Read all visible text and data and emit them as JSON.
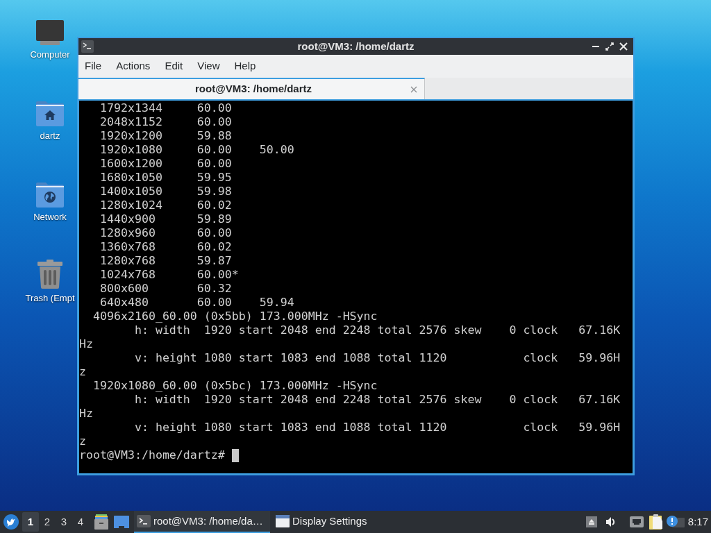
{
  "desktop_icons": [
    {
      "label": "Computer",
      "kind": "computer"
    },
    {
      "label": "dartz",
      "kind": "home"
    },
    {
      "label": "Network",
      "kind": "network"
    },
    {
      "label": "Trash (Empt",
      "kind": "trash"
    }
  ],
  "window": {
    "title": "root@VM3: /home/dartz",
    "menu": [
      "File",
      "Actions",
      "Edit",
      "View",
      "Help"
    ],
    "tabs": [
      {
        "label": "root@VM3: /home/dartz",
        "selected": true
      }
    ],
    "terminal": {
      "lines": [
        "   1792x1344     60.00",
        "   2048x1152     60.00",
        "   1920x1200     59.88",
        "   1920x1080     60.00    50.00",
        "   1600x1200     60.00",
        "   1680x1050     59.95",
        "   1400x1050     59.98",
        "   1280x1024     60.02",
        "   1440x900      59.89",
        "   1280x960      60.00",
        "   1360x768      60.02",
        "   1280x768      59.87",
        "   1024x768      60.00*",
        "   800x600       60.32",
        "   640x480       60.00    59.94",
        "  4096x2160_60.00 (0x5bb) 173.000MHz -HSync",
        "        h: width  1920 start 2048 end 2248 total 2576 skew    0 clock   67.16K",
        "Hz",
        "        v: height 1080 start 1083 end 1088 total 1120           clock   59.96H",
        "z",
        "  1920x1080_60.00 (0x5bc) 173.000MHz -HSync",
        "        h: width  1920 start 2048 end 2248 total 2576 skew    0 clock   67.16K",
        "Hz",
        "        v: height 1080 start 1083 end 1088 total 1120           clock   59.96H",
        "z"
      ],
      "prompt": "root@VM3:/home/dartz#"
    }
  },
  "taskbar": {
    "workspaces": [
      {
        "label": "1",
        "selected": true
      },
      {
        "label": "2",
        "selected": false
      },
      {
        "label": "3",
        "selected": false
      },
      {
        "label": "4",
        "selected": false
      }
    ],
    "tasks": [
      {
        "label": "root@VM3: /home/da…",
        "kind": "terminal",
        "selected": true
      },
      {
        "label": "Display Settings",
        "kind": "window",
        "selected": false
      }
    ],
    "clock": "8:17"
  }
}
